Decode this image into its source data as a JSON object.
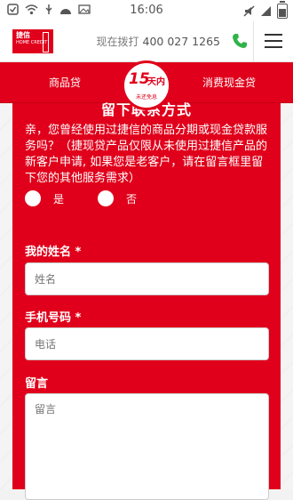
{
  "status_bar": {
    "time": "16:06"
  },
  "header": {
    "logo_cn": "捷信",
    "logo_en": "HOME CREDIT",
    "call_text": "现在拨打",
    "phone_number": "400 027 1265"
  },
  "nav": {
    "left": "商品贷",
    "right": "消费现金贷",
    "badge_number": "15",
    "badge_unit": "天内",
    "badge_sub": "未还免息"
  },
  "form": {
    "title": "留下联系方式",
    "question": "亲，您曾经使用过捷信的商品分期或现金贷款服务吗？（捷现贷产品仅限从未使用过捷信产品的新客户申请, 如果您是老客户，请在留言框里留下您的其他服务需求）",
    "yes_label": "是",
    "no_label": "否",
    "name_label": "我的姓名 *",
    "name_placeholder": "姓名",
    "phone_label": "手机号码 *",
    "phone_placeholder": "电话",
    "message_label": "留言",
    "message_placeholder": "留言"
  },
  "colors": {
    "brand_red": "#e0001b",
    "phone_green": "#2fb34a"
  }
}
